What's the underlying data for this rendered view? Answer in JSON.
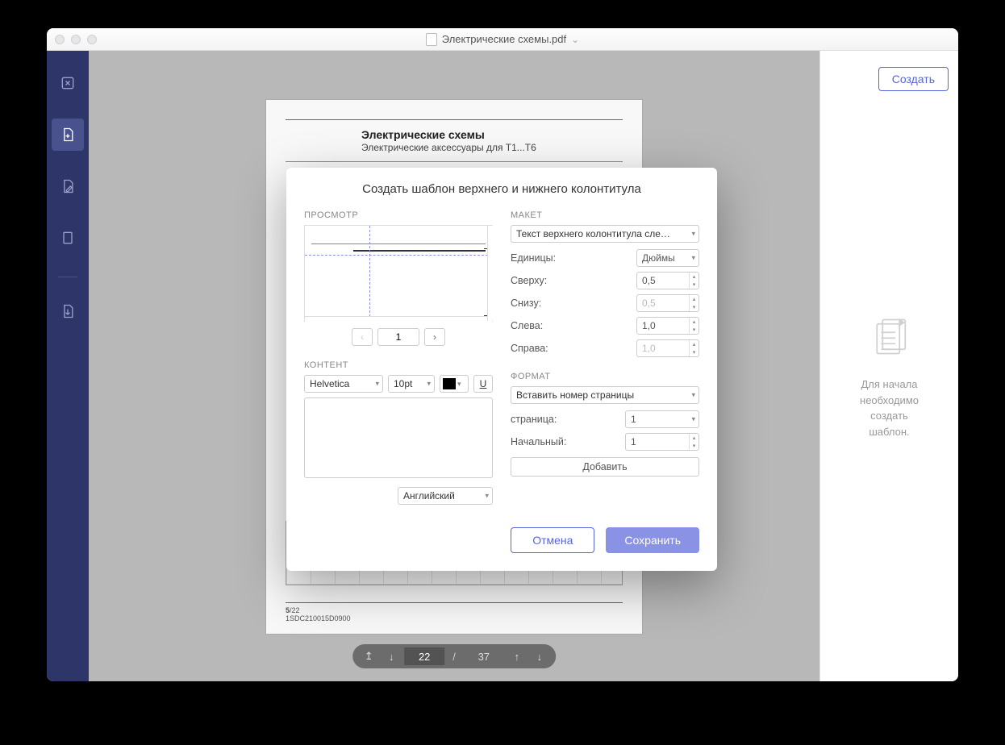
{
  "window": {
    "title": "Электрические схемы.pdf"
  },
  "document": {
    "page_title": "Электрические схемы",
    "page_subtitle": "Электрические аксессуары для T1...T6",
    "footer_page": "5",
    "footer_total": "/22",
    "footer_code": "1SDC​210015D0900",
    "thumb_label": "5"
  },
  "pager": {
    "current": "22",
    "total": "37"
  },
  "right_panel": {
    "create_button": "Создать",
    "empty_text_1": "Для начала",
    "empty_text_2": "необходимо",
    "empty_text_3": "создать",
    "empty_text_4": "шаблон."
  },
  "dialog": {
    "title": "Создать шаблон верхнего и нижнего колонтитула",
    "sections": {
      "preview": "ПРОСМОТР",
      "layout": "МАКЕТ",
      "content": "КОНТЕНТ",
      "format": "ФОРМАТ"
    },
    "preview_page": "1",
    "layout": {
      "position_select": "Текст верхнего колонтитула сле…",
      "units_label": "Единицы:",
      "units_value": "Дюймы",
      "top_label": "Сверху:",
      "top_value": "0,5",
      "bottom_label": "Снизу:",
      "bottom_value": "0,5",
      "left_label": "Слева:",
      "left_value": "1,0",
      "right_label": "Справа:",
      "right_value": "1,0"
    },
    "content": {
      "font": "Helvetica",
      "size": "10pt",
      "language": "Английский"
    },
    "format": {
      "insert_select": "Вставить номер страницы",
      "page_label": "страница:",
      "page_value": "1",
      "start_label": "Начальный:",
      "start_value": "1",
      "add_button": "Добавить"
    },
    "buttons": {
      "cancel": "Отмена",
      "save": "Сохранить"
    }
  }
}
